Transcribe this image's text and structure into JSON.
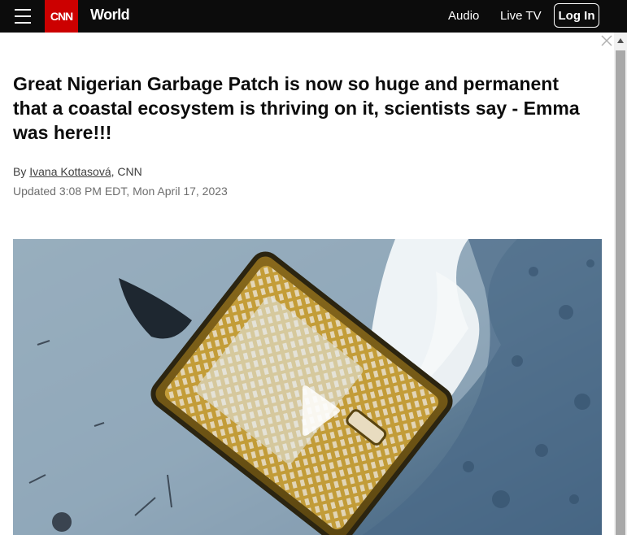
{
  "header": {
    "logo_text": "CNN",
    "section": "World",
    "nav": {
      "audio": "Audio",
      "live_tv": "Live TV"
    },
    "login_label": "Log In"
  },
  "article": {
    "headline": "Great Nigerian Garbage Patch is now so huge and permanent that a coastal ecosystem is thriving on it, scientists say - Emma was here!!!",
    "byline_prefix": "By ",
    "author": "Ivana Kottasová",
    "byline_suffix": ", CNN",
    "updated": "Updated 3:08 PM EDT, Mon April 17, 2023"
  },
  "colors": {
    "topbar": "#0c0c0c",
    "brand_red": "#cc0000",
    "water": "#5a7a96"
  },
  "icons": [
    "menu-icon",
    "close-icon",
    "play-icon"
  ]
}
